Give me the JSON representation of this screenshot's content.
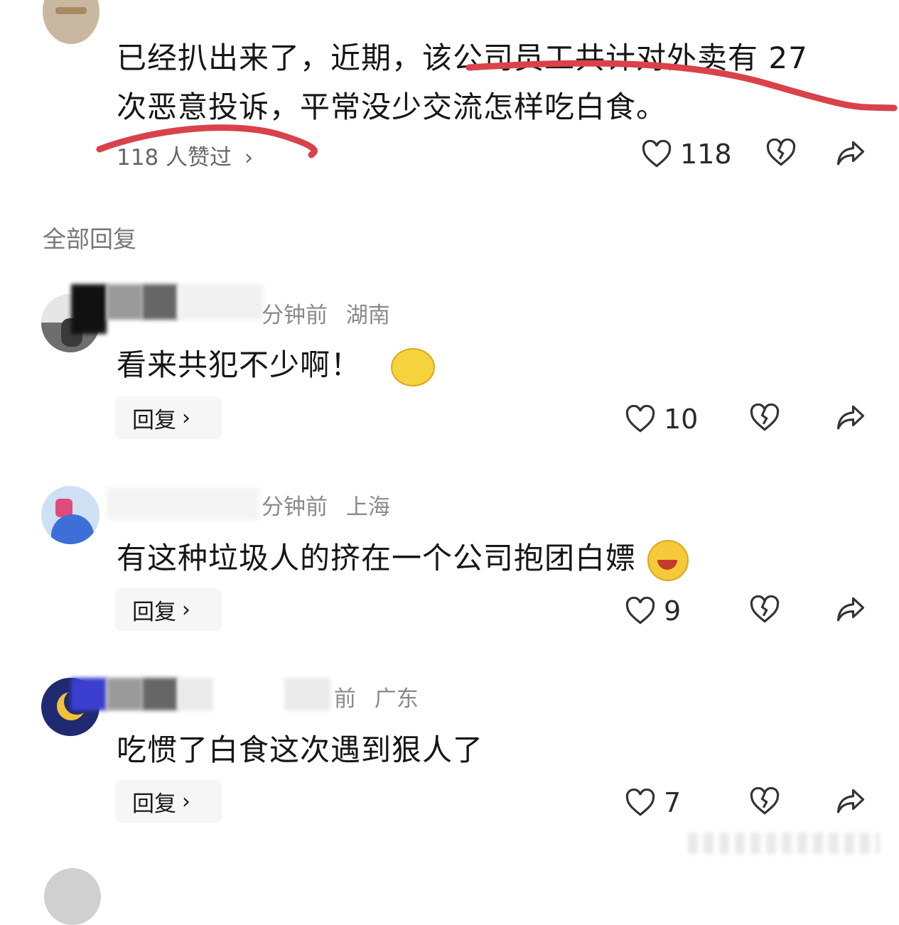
{
  "top_comment": {
    "line1": "已经扒出来了，近期，该公司员工共计对外卖有 27",
    "line2": "次恶意投诉，平常没少交流怎样吃白食。",
    "likes_summary": "118 人赞过",
    "likes_count": "118"
  },
  "section_title": "全部回复",
  "replies": [
    {
      "time": "分钟前",
      "location": "湖南",
      "text": "看来共犯不少啊！",
      "reply_label": "回复",
      "likes": "10"
    },
    {
      "time": "分钟前",
      "location": "上海",
      "text": "有这种垃圾人的挤在一个公司抱团白嫖",
      "reply_label": "回复",
      "likes": "9"
    },
    {
      "time": "前",
      "location": "广东",
      "text": "吃惯了白食这次遇到狠人了",
      "reply_label": "回复",
      "likes": "7"
    }
  ],
  "icons": {
    "like": "heart-outline-icon",
    "dislike": "broken-heart-icon",
    "share": "share-arrow-icon",
    "chevron": "chevron-right-icon"
  },
  "colors": {
    "annotation_red": "#d9424a",
    "meta_gray": "#8a8a8a"
  }
}
